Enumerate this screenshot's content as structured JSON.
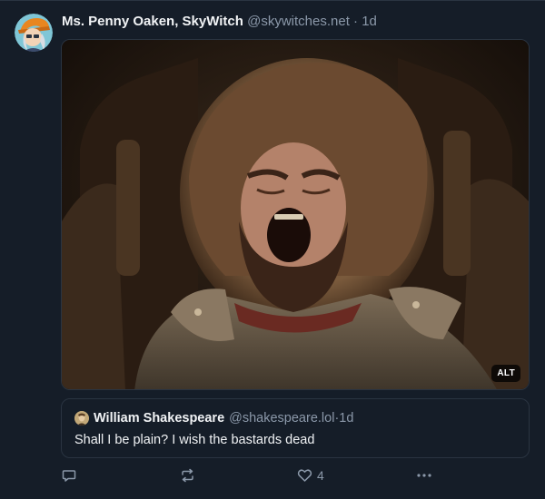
{
  "post": {
    "display_name": "Ms. Penny Oaken, SkyWitch",
    "handle": "@skywitches.net",
    "separator": " · ",
    "time": "1d",
    "avatar_icon": "witch-avatar"
  },
  "media": {
    "alt_badge": "ALT",
    "image_icon": "screaming-bearded-king-photo"
  },
  "quote": {
    "author": "William Shakespeare",
    "handle": "@shakespeare.lol",
    "separator": " · ",
    "time": "1d",
    "text": "Shall I be plain? I wish the bastards dead"
  },
  "actions": {
    "reply_icon": "reply-icon",
    "repost_icon": "repost-icon",
    "like_icon": "heart-icon",
    "like_count": "4",
    "more_icon": "more-icon"
  },
  "colors": {
    "background": "#151d28",
    "border": "#2a3441",
    "muted_text": "#8b98a9",
    "primary_text": "#f1f3f5"
  }
}
